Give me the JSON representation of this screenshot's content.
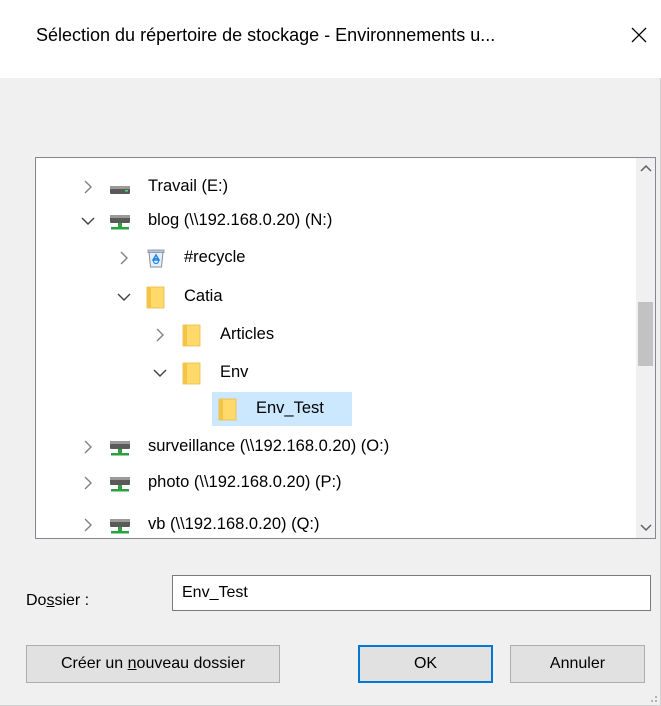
{
  "window": {
    "title": "Sélection du répertoire de stockage - Environnements u...",
    "close_glyph": "✕"
  },
  "tree": {
    "items": [
      {
        "label": "Travail (E:)",
        "icon": "drive-icon",
        "expanded": false,
        "level": 0
      },
      {
        "label": "blog (\\\\192.168.0.20) (N:)",
        "icon": "network-drive-icon",
        "expanded": true,
        "level": 0
      },
      {
        "label": "#recycle",
        "icon": "recycle-bin-icon",
        "expanded": false,
        "level": 1
      },
      {
        "label": "Catia",
        "icon": "folder-icon",
        "expanded": true,
        "level": 1
      },
      {
        "label": "Articles",
        "icon": "folder-icon",
        "expanded": false,
        "level": 2
      },
      {
        "label": "Env",
        "icon": "folder-icon",
        "expanded": true,
        "level": 2
      },
      {
        "label": "Env_Test",
        "icon": "folder-icon",
        "expanded": null,
        "level": 3,
        "selected": true
      },
      {
        "label": "surveillance (\\\\192.168.0.20) (O:)",
        "icon": "network-drive-icon",
        "expanded": false,
        "level": 0
      },
      {
        "label": "photo (\\\\192.168.0.20) (P:)",
        "icon": "network-drive-icon",
        "expanded": false,
        "level": 0
      },
      {
        "label": "vb (\\\\192.168.0.20) (Q:)",
        "icon": "network-drive-icon",
        "expanded": false,
        "level": 0
      }
    ]
  },
  "folder": {
    "label_pre": "Do",
    "label_accel": "s",
    "label_post": "sier :",
    "value": "Env_Test"
  },
  "buttons": {
    "new_folder_pre": "Créer un ",
    "new_folder_accel": "n",
    "new_folder_post": "ouveau dossier",
    "ok": "OK",
    "cancel": "Annuler"
  },
  "colors": {
    "selection": "#cce8ff",
    "default_button_border": "#0078d7",
    "folder_yellow": "#ffd96a",
    "drive_green": "#2ea043"
  }
}
